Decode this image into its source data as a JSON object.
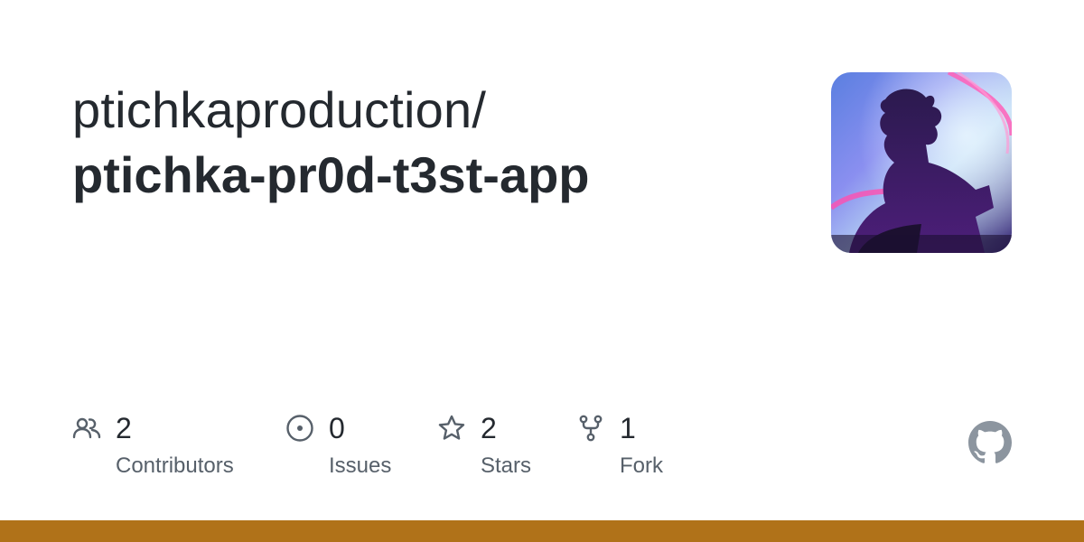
{
  "repo": {
    "owner": "ptichkaproduction/",
    "name": "ptichka-pr0d-t3st-app"
  },
  "avatar": {
    "icon": "avatar-image"
  },
  "stats": [
    {
      "value": "2",
      "label": "Contributors",
      "icon": "people-icon"
    },
    {
      "value": "0",
      "label": "Issues",
      "icon": "issue-opened-icon"
    },
    {
      "value": "2",
      "label": "Stars",
      "icon": "star-icon"
    },
    {
      "value": "1",
      "label": "Fork",
      "icon": "repo-forked-icon"
    }
  ],
  "colors": {
    "text_primary": "#24292f",
    "text_secondary": "#57606a",
    "icon": "#57606a",
    "language_bar": "#b07219",
    "github_logo": "#8c959f"
  }
}
